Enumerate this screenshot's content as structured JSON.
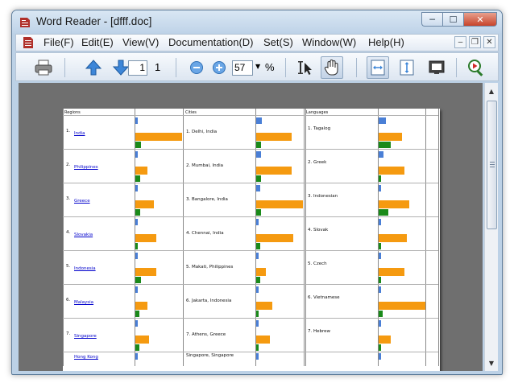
{
  "window": {
    "title": "Word Reader - [dfff.doc]",
    "controls": {
      "minimize": "─",
      "maximize": "☐",
      "close": "✕"
    }
  },
  "menubar": {
    "items": [
      "File(F)",
      "Edit(E)",
      "View(V)",
      "Documentation(D)",
      "Set(S)",
      "Window(W)",
      "Help(H)"
    ],
    "mdi_controls": {
      "minimize": "–",
      "restore": "❐",
      "close": "✕"
    }
  },
  "toolbar": {
    "page_input": "1",
    "page_total": "1",
    "zoom_value": "57",
    "zoom_unit": "%"
  },
  "document": {
    "headers": [
      "Regions",
      "Cities",
      "Languages"
    ],
    "rows": [
      {
        "region_no": "1.",
        "region": "India",
        "city": "1.  Delhi, India",
        "language": "1.  Tagalog",
        "bars": {
          "r": [
            0.05,
            1.0,
            0.12
          ],
          "c": [
            0.12,
            0.75,
            0.1
          ],
          "l": [
            0.15,
            0.5,
            0.25
          ]
        }
      },
      {
        "region_no": "2.",
        "region": "Philippines",
        "city": "2.  Mumbai, India",
        "language": "2.  Greek",
        "bars": {
          "r": [
            0.03,
            0.25,
            0.1
          ],
          "c": [
            0.1,
            0.75,
            0.1
          ],
          "l": [
            0.1,
            0.55,
            0.05
          ]
        }
      },
      {
        "region_no": "3.",
        "region": "Greece",
        "city": "3.  Bangalore, India",
        "language": "3.  Indonesian",
        "bars": {
          "r": [
            0.03,
            0.4,
            0.1
          ],
          "c": [
            0.08,
            1.0,
            0.1
          ],
          "l": [
            0.05,
            0.65,
            0.2
          ]
        }
      },
      {
        "region_no": "4.",
        "region": "Slovakia",
        "city": "4.  Chennai, India",
        "language": "4.  Slovak",
        "bars": {
          "r": [
            0.03,
            0.45,
            0.06
          ],
          "c": [
            0.06,
            0.8,
            0.08
          ],
          "l": [
            0.05,
            0.6,
            0.06
          ]
        }
      },
      {
        "region_no": "5.",
        "region": "Indonesia",
        "city": "5.  Makati, Philippines",
        "language": "5.  Czech",
        "bars": {
          "r": [
            0.03,
            0.45,
            0.12
          ],
          "c": [
            0.03,
            0.2,
            0.08
          ],
          "l": [
            0.05,
            0.55,
            0.05
          ]
        }
      },
      {
        "region_no": "6.",
        "region": "Malaysia",
        "city": "6.  Jakarta, Indonesia",
        "language": "6.  Vietnamese",
        "bars": {
          "r": [
            0.03,
            0.25,
            0.08
          ],
          "c": [
            0.03,
            0.35,
            0.06
          ],
          "l": [
            0.03,
            1.0,
            0.08
          ]
        }
      },
      {
        "region_no": "7.",
        "region": "Singapore",
        "city": "7.  Athens, Greece",
        "language": "7.  Hebrew",
        "bars": {
          "r": [
            0.03,
            0.3,
            0.08
          ],
          "c": [
            0.03,
            0.3,
            0.05
          ],
          "l": [
            0.03,
            0.25,
            0.03
          ]
        }
      },
      {
        "region_no": "",
        "region": "Hong Kong",
        "city": "Singapore, Singapore",
        "language": "",
        "bars": {
          "r": [
            0.03,
            0,
            0
          ],
          "c": [
            0.03,
            0,
            0
          ],
          "l": [
            0.03,
            0,
            0
          ]
        }
      }
    ]
  },
  "colors": {
    "bar_blue": "#4a7fd6",
    "bar_orange": "#f59a10",
    "bar_green": "#1a8a1a",
    "viewport_bg": "#6f6f6f"
  }
}
